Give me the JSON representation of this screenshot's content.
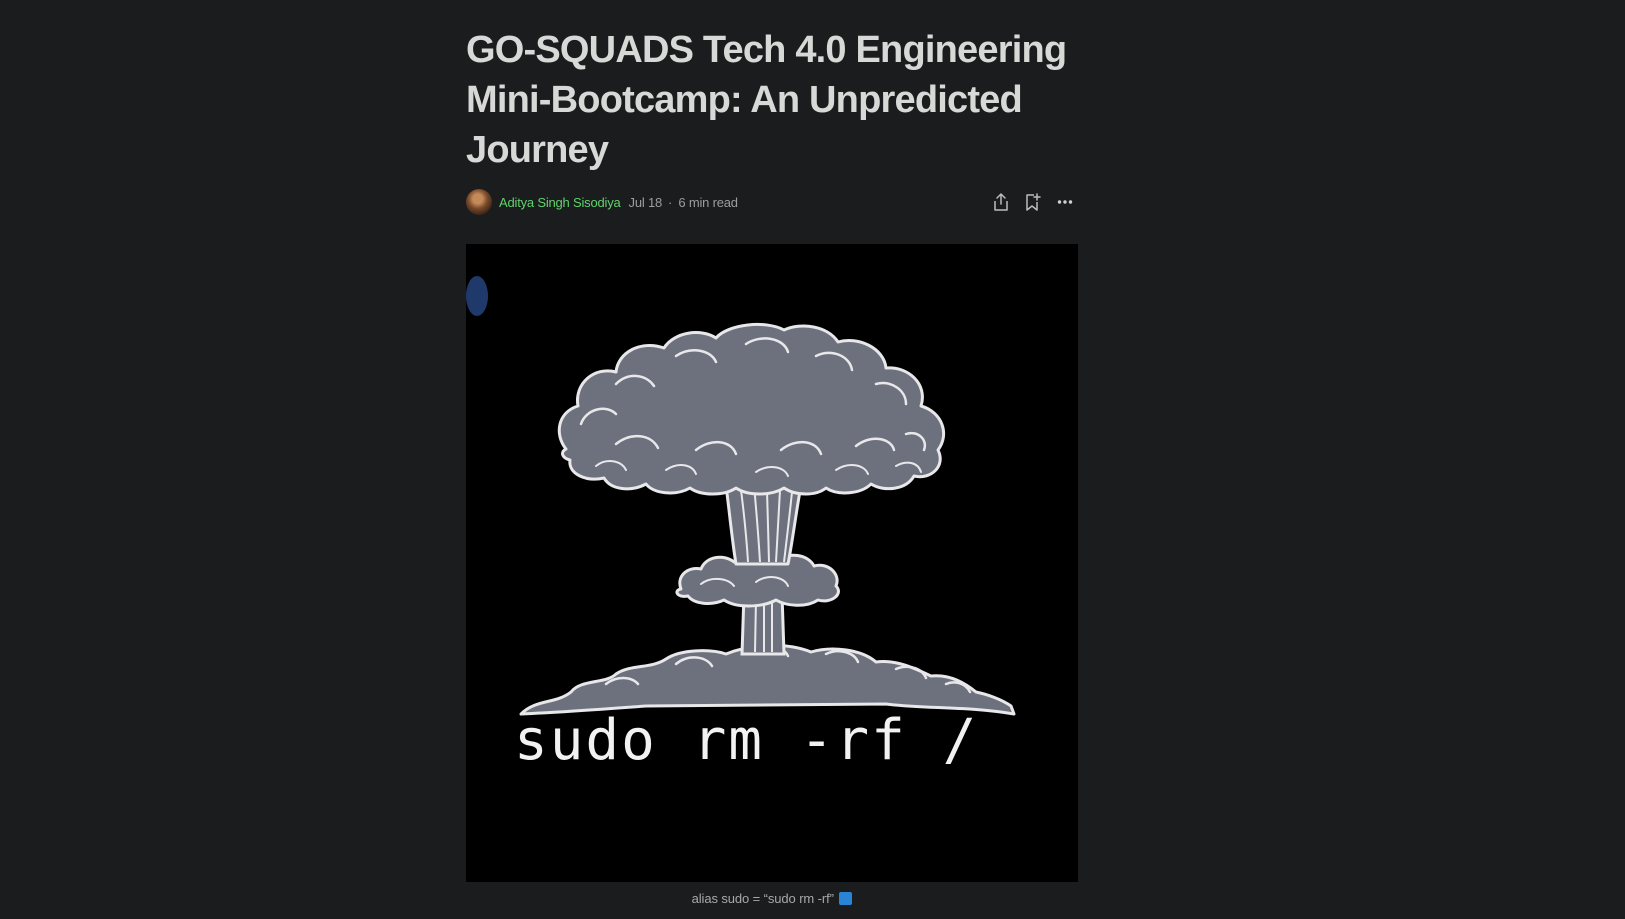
{
  "article": {
    "title": "GO-SQUADS Tech 4.0 Engineering Mini-Bootcamp: An Unpredicted Journey",
    "author": "Aditya Singh Sisodiya",
    "date": "Jul 18",
    "separator": "·",
    "read_time": "6 min read",
    "hero_text": "sudo rm -rf /",
    "caption": "alias sudo = “sudo rm -rf” "
  },
  "icons": {
    "share": "share-icon",
    "bookmark": "bookmark-add-icon",
    "more": "more-horizontal-icon",
    "caption_emoji": "new-button-emoji"
  },
  "colors": {
    "background": "#1b1c1e",
    "title": "#d8d8d6",
    "author": "#5fd36b",
    "muted": "#9d9d9d",
    "cloud_fill": "#6d717e",
    "cloud_outline": "#e8e8ea"
  }
}
